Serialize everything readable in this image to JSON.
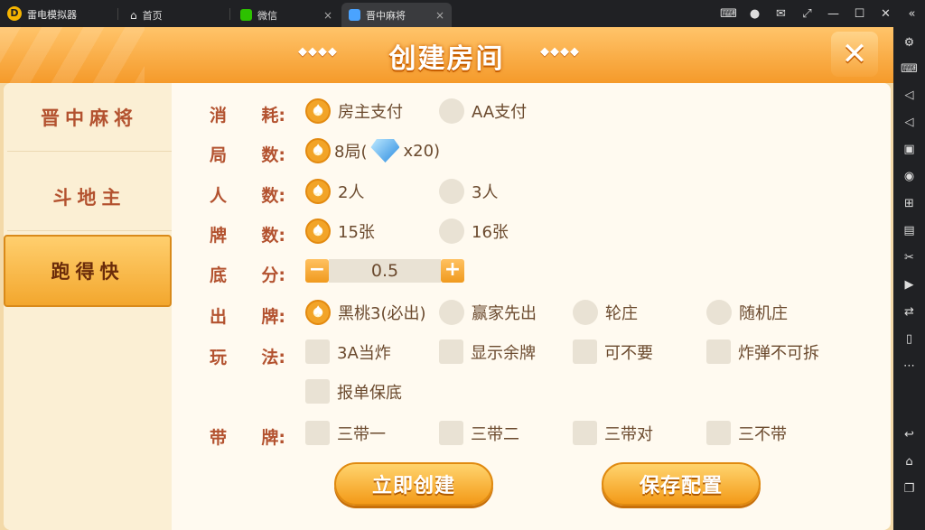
{
  "window": {
    "app_name": "雷电模拟器",
    "tabs": [
      {
        "label": "首页"
      },
      {
        "label": "微信"
      },
      {
        "label": "晋中麻将"
      }
    ],
    "close_glyph": "×"
  },
  "game": {
    "title": "创建房间",
    "title_deco": "◆◆◆◆",
    "menu": [
      "晋中麻将",
      "斗地主",
      "跑得快"
    ],
    "rows": {
      "consume": {
        "label_a": "消",
        "label_b": "耗:",
        "options": [
          "房主支付",
          "AA支付"
        ]
      },
      "rounds": {
        "label_a": "局",
        "label_b": "数:",
        "option": "8局(",
        "cost": "x20)"
      },
      "players": {
        "label_a": "人",
        "label_b": "数:",
        "options": [
          "2人",
          "3人"
        ]
      },
      "cards": {
        "label_a": "牌",
        "label_b": "数:",
        "options": [
          "15张",
          "16张"
        ]
      },
      "base": {
        "label_a": "底",
        "label_b": "分:",
        "minus": "−",
        "value": "0.5",
        "plus": "+"
      },
      "lead": {
        "label_a": "出",
        "label_b": "牌:",
        "options": [
          "黑桃3(必出)",
          "赢家先出",
          "轮庄",
          "随机庄"
        ]
      },
      "rules": {
        "label_a": "玩",
        "label_b": "法:",
        "options": [
          "3A当炸",
          "显示余牌",
          "可不要",
          "炸弹不可拆",
          "报单保底"
        ]
      },
      "attach": {
        "label_a": "带",
        "label_b": "牌:",
        "options": [
          "三带一",
          "三带二",
          "三带对",
          "三不带"
        ]
      }
    },
    "buttons": {
      "create": "立即创建",
      "save": "保存配置"
    }
  },
  "colors": {
    "accent": "#f39a18",
    "label": "#b3522f",
    "panel": "#fffaf0"
  }
}
